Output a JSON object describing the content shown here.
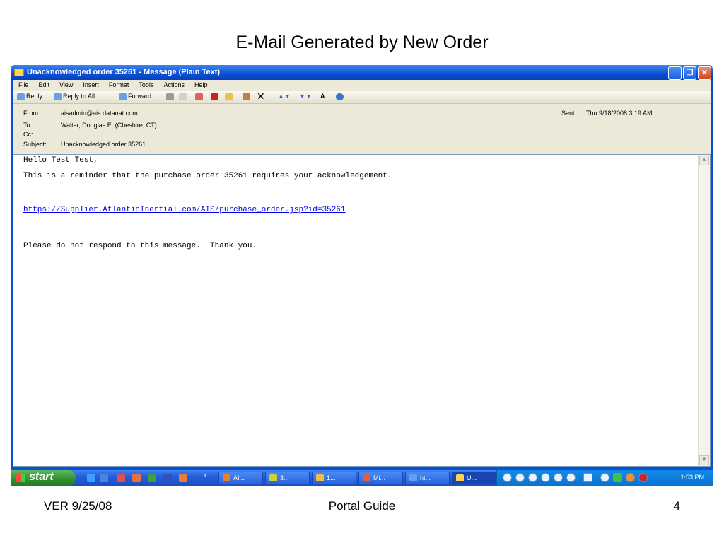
{
  "slide": {
    "title": "E-Mail Generated by New Order",
    "footer_left": "VER 9/25/08",
    "footer_center": "Portal Guide",
    "footer_right": "4"
  },
  "window": {
    "title": "Unacknowledged order 35261 - Message (Plain Text)",
    "controls": {
      "minimize": "_",
      "restore": "❐",
      "close": "✕"
    }
  },
  "menu": [
    "File",
    "Edit",
    "View",
    "Insert",
    "Format",
    "Tools",
    "Actions",
    "Help"
  ],
  "toolbar": {
    "reply": "Reply",
    "reply_all": "Reply to All",
    "forward": "Forward"
  },
  "header": {
    "from_label": "From:",
    "from": "aisadmin@ais.datanat.com",
    "to_label": "To:",
    "to": "Walter, Douglas E. (Cheshire, CT)",
    "cc_label": "Cc:",
    "cc": "",
    "subject_label": "Subject:",
    "subject": "Unacknowledged order 35261",
    "sent_label": "Sent:",
    "sent": "Thu 9/18/2008 3:19 AM"
  },
  "body": {
    "greeting": "Hello Test Test,",
    "reminder": "This is a reminder that the purchase order 35261 requires your acknowledgement.",
    "link": "https://Supplier.AtlanticInertial.com/AIS/purchase_order.jsp?id=35261",
    "closing": "Please do not respond to this message.  Thank you."
  },
  "taskbar": {
    "start": "start",
    "tasks": [
      "AI...",
      "3...",
      "1...",
      "Mi...",
      "ht...",
      "U..."
    ],
    "clock": "1:53 PM"
  }
}
